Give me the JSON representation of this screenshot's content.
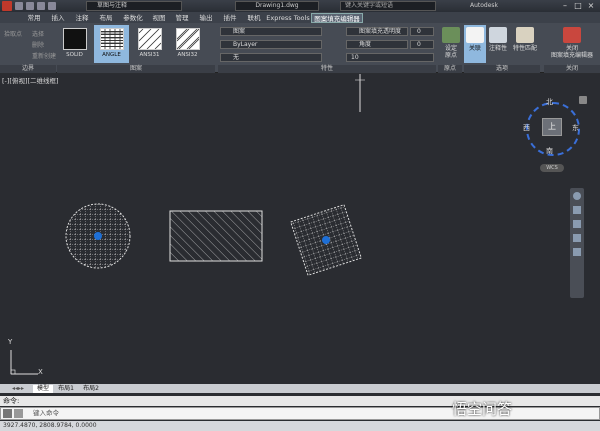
{
  "titlebar": {
    "workspace": "草图与注释",
    "document": "Drawing1.dwg",
    "search_placeholder": "键入关键字或短语",
    "user": "Autodesk",
    "minimize": "–",
    "maximize": "□",
    "close": "×"
  },
  "tabs": [
    "常用",
    "插入",
    "注释",
    "布局",
    "参数化",
    "视图",
    "管理",
    "输出",
    "插件",
    "联机",
    "Express Tools",
    "图案填充编辑器"
  ],
  "ribbon": {
    "boundary": {
      "title": "边界",
      "pick_points": "拾取点",
      "select": "选择",
      "remove": "删除",
      "recreate": "重新创建"
    },
    "pattern": {
      "title": "图案",
      "swatches": [
        "SOLID",
        "ANGLE",
        "ANSI31",
        "ANSI32"
      ]
    },
    "properties": {
      "title": "特性",
      "type": "图案",
      "color": "ByLayer",
      "background": "无",
      "transparency_label": "图案填充透明度",
      "transparency_value": "0",
      "angle_label": "角度",
      "angle_value": "0",
      "scale_value": "10"
    },
    "origin": {
      "title": "原点",
      "set_origin": "设定\n原点"
    },
    "options": {
      "title": "选项",
      "associative": "关联",
      "annotative": "注释性",
      "match": "特性匹配"
    },
    "close": {
      "title": "关闭",
      "close_editor": "关闭\n图案填充编辑器"
    }
  },
  "canvas": {
    "view_label": "[-][俯视][二维线框]",
    "viewcube": {
      "north": "北",
      "south": "南",
      "west": "西",
      "east": "东",
      "top": "上",
      "wcs": "WCS"
    },
    "ucs_y": "Y",
    "ucs_x": "X"
  },
  "layout_tabs": [
    "模型",
    "布局1",
    "布局2"
  ],
  "command": {
    "history": "命令:",
    "placeholder": "键入命令"
  },
  "status": {
    "coords": "3927.4870, 2808.9784, 0.0000"
  },
  "watermark": "悟空问答"
}
